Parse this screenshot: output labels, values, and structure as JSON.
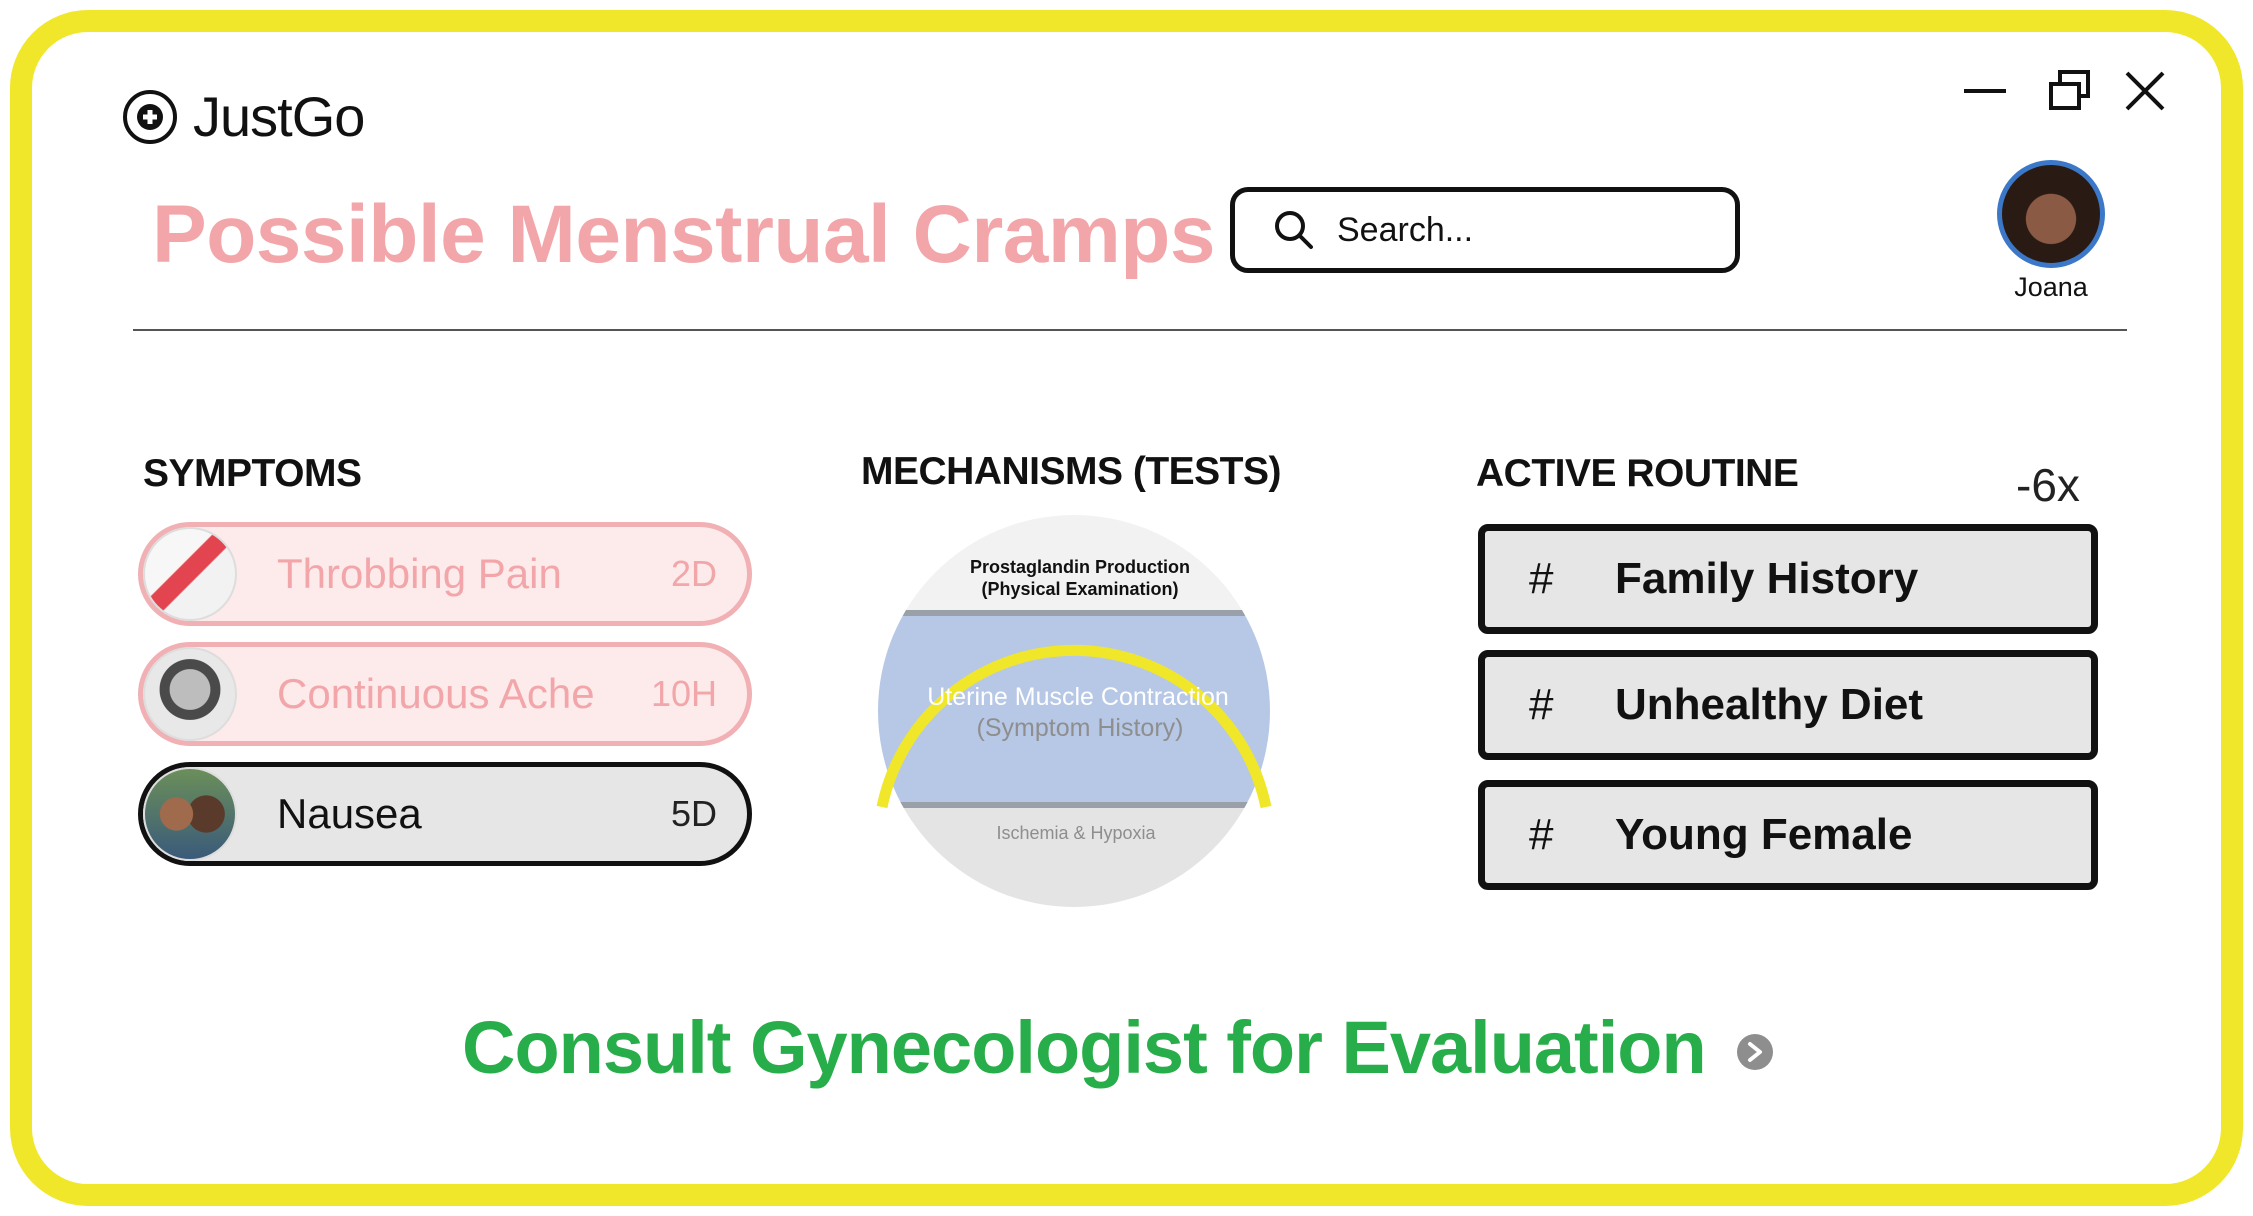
{
  "app": {
    "name": "JustGo"
  },
  "window_controls": [
    "minimize-icon",
    "restore-icon",
    "close-icon"
  ],
  "header": {
    "title": "Possible Menstrual Cramps",
    "search_placeholder": "Search...",
    "user_name": "Joana"
  },
  "symptoms": {
    "heading": "SYMPTOMS",
    "items": [
      {
        "label": "Throbbing Pain",
        "duration": "2D",
        "state": "faded"
      },
      {
        "label": "Continuous Ache",
        "duration": "10H",
        "state": "faded"
      },
      {
        "label": "Nausea",
        "duration": "5D",
        "state": "active"
      }
    ]
  },
  "mechanisms": {
    "heading": "MECHANISMS (TESTS)",
    "layers": [
      {
        "line1": "Prostaglandin Production",
        "line2": "(Physical Examination)"
      },
      {
        "line1": "Uterine Muscle Contraction",
        "line2": "(Symptom History)"
      },
      {
        "line1": "Ischemia & Hypoxia"
      }
    ]
  },
  "routine": {
    "heading": "ACTIVE ROUTINE",
    "count": "-6x",
    "items": [
      {
        "hash": "#",
        "label": "Family History"
      },
      {
        "hash": "#",
        "label": "Unhealthy Diet"
      },
      {
        "hash": "#",
        "label": "Young Female"
      }
    ]
  },
  "cta": {
    "label": "Consult Gynecologist for Evaluation"
  },
  "colors": {
    "frame": "#f0e62a",
    "title_pink": "#f2a6aa",
    "cta_green": "#27ae4a",
    "mechanism_blue": "#b7c8e6",
    "avatar_ring": "#3c78c8"
  }
}
